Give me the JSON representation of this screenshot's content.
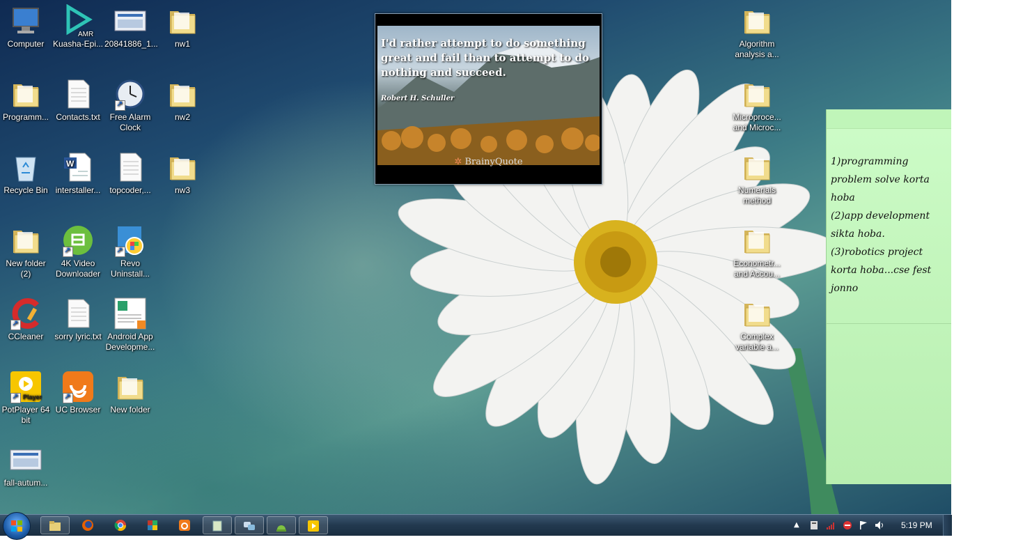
{
  "desktop_icons": [
    {
      "label": "Computer",
      "icon": "computer-icon"
    },
    {
      "label": "Kuasha-Epi...",
      "icon": "amr-media-icon"
    },
    {
      "label": "20841886_1...",
      "icon": "image-file-icon"
    },
    {
      "label": "nw1",
      "icon": "folder-icon"
    },
    {
      "label": "Programm...",
      "icon": "folder-icon"
    },
    {
      "label": "Contacts.txt",
      "icon": "text-file-icon"
    },
    {
      "label": "Free Alarm\nClock",
      "icon": "alarm-clock-icon"
    },
    {
      "label": "nw2",
      "icon": "folder-icon"
    },
    {
      "label": "Recycle Bin",
      "icon": "recycle-bin-icon"
    },
    {
      "label": "interstaller...",
      "icon": "word-document-icon"
    },
    {
      "label": "topcoder,...",
      "icon": "text-file-icon"
    },
    {
      "label": "nw3",
      "icon": "folder-icon"
    },
    {
      "label": "New folder\n(2)",
      "icon": "folder-icon"
    },
    {
      "label": "4K Video\nDownloader",
      "icon": "4k-downloader-icon"
    },
    {
      "label": "Revo\nUninstall...",
      "icon": "revo-uninstaller-icon"
    },
    {
      "label": "CCleaner",
      "icon": "ccleaner-icon"
    },
    {
      "label": "sorry lyric.txt",
      "icon": "text-file-icon"
    },
    {
      "label": "Android App\nDevelopme...",
      "icon": "pdf-document-icon"
    },
    {
      "label": "PotPlayer 64\nbit",
      "icon": "potplayer-icon"
    },
    {
      "label": "UC Browser",
      "icon": "uc-browser-icon"
    },
    {
      "label": "New folder",
      "icon": "folder-icon"
    },
    {
      "label": "fall-autum...",
      "icon": "image-file-icon"
    },
    {
      "label": "Algorithm\nanalysis a...",
      "icon": "folder-icon"
    },
    {
      "label": "Microproce...\nand Microc...",
      "icon": "folder-icon"
    },
    {
      "label": "Numerials\nmethod",
      "icon": "folder-icon"
    },
    {
      "label": "Econometr...\nand Accou...",
      "icon": "folder-icon"
    },
    {
      "label": "Complex\nvariable a...",
      "icon": "folder-icon"
    }
  ],
  "quote_gadget": {
    "quote": "I'd rather attempt to do something great and fail than to attempt to do nothing and succeed.",
    "author": "Robert H. Schuller",
    "brand": "BrainyQuote"
  },
  "sticky_note": {
    "text": "1)programming problem solve korta hoba\n(2)app development sikta hoba.\n(3)robotics project korta hoba...cse fest jonno"
  },
  "taskbar": {
    "items": [
      "start-button",
      "windows-explorer-icon",
      "firefox-icon",
      "chrome-icon",
      "winrar-icon",
      "uc-browser-icon",
      "sticky-notes-icon",
      "chat-messenger-icon",
      "android-studio-icon",
      "potplayer-icon"
    ],
    "clock": "5:19 PM",
    "tray": [
      "show-hidden-icons",
      "action-center-flag-icon",
      "network-signal-icon",
      "security-icon",
      "flag-icon",
      "volume-icon"
    ]
  },
  "colors": {
    "sticky": "#c8f8c2",
    "taskbar": "#22394f",
    "folder": "#e8cf78"
  }
}
